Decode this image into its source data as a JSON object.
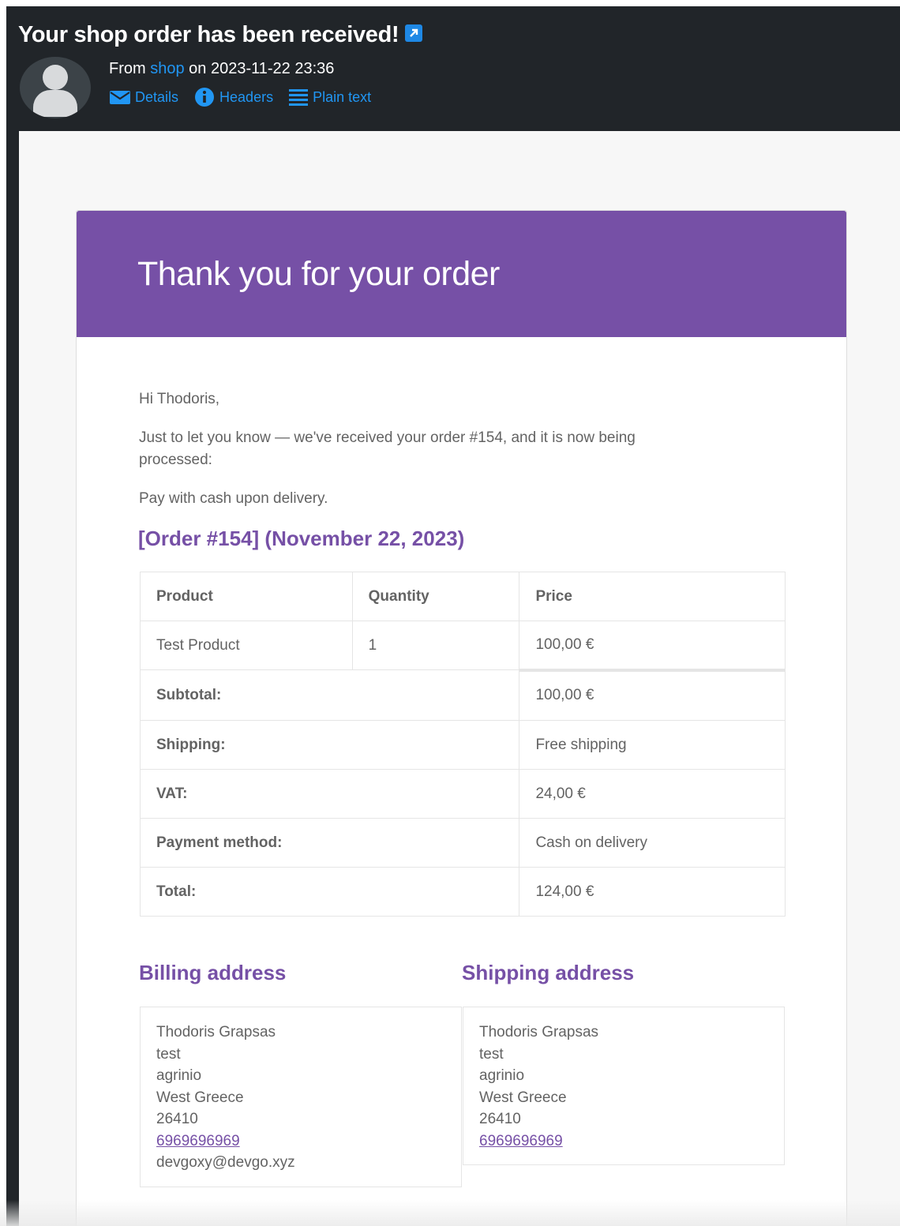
{
  "mail": {
    "subject": "Your shop order has been received!",
    "from_prefix": "From",
    "from_sender": "shop",
    "from_date": "on 2023-11-22 23:36",
    "links": {
      "details": "Details",
      "headers": "Headers",
      "plain_text": "Plain text"
    }
  },
  "email": {
    "hero_title": "Thank you for your order",
    "greeting": "Hi Thodoris,",
    "intro_line1": "Just to let you know — we've received your order #154, and it is now being",
    "intro_line2": "processed:",
    "payment_note": "Pay with cash upon delivery.",
    "order_heading": "[Order #154] (November 22, 2023)",
    "table": {
      "headers": [
        "Product",
        "Quantity",
        "Price"
      ],
      "rows": [
        {
          "product": "Test Product",
          "quantity": "1",
          "price": "100,00 €"
        }
      ],
      "totals": [
        {
          "label": "Subtotal:",
          "value": "100,00 €"
        },
        {
          "label": "Shipping:",
          "value": "Free shipping"
        },
        {
          "label": "VAT:",
          "value": "24,00 €"
        },
        {
          "label": "Payment method:",
          "value": "Cash on delivery"
        },
        {
          "label": "Total:",
          "value": "124,00 €"
        }
      ]
    },
    "billing": {
      "heading": "Billing address",
      "name": "Thodoris Grapsas",
      "line1": "test",
      "city": "agrinio",
      "region": "West Greece",
      "postcode": "26410",
      "phone": "6969696969",
      "email": "devgoxy@devgo.xyz"
    },
    "shipping": {
      "heading": "Shipping address",
      "name": "Thodoris Grapsas",
      "line1": "test",
      "city": "agrinio",
      "region": "West Greece",
      "postcode": "26410",
      "phone": "6969696969"
    }
  },
  "colors": {
    "header_bg": "#212529",
    "link_blue": "#2196f3",
    "brand_purple": "#7650a6",
    "text_gray": "#636363"
  },
  "icons": {
    "external": "external-link-icon",
    "avatar": "user-avatar-icon",
    "details": "envelope-icon",
    "headers": "info-icon",
    "plain_text": "list-lines-icon"
  }
}
